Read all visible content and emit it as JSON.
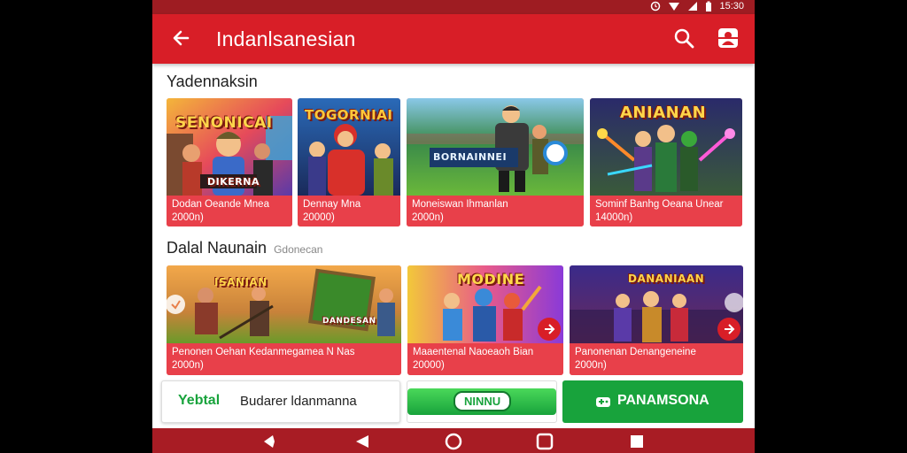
{
  "status": {
    "time": "15:30"
  },
  "appbar": {
    "title": "Indanlsanesian"
  },
  "section1": {
    "title": "Yadennaksin",
    "cards": [
      {
        "banner": "SENONICAI",
        "subbanner": "DIKERNA",
        "caption": "Dodan Oeande Mnea",
        "price": "2000n)"
      },
      {
        "banner": "TOGORNIAI",
        "caption": "Dennay Mna",
        "price": "20000)"
      },
      {
        "banner": "BORNAINNEI",
        "caption": "Moneiswan Ihmanlan",
        "price": "2000n)"
      },
      {
        "banner": "ANIANAN",
        "caption": "Sominf Banhg Oeana Unear",
        "price": "14000n)"
      }
    ]
  },
  "section2": {
    "title": "Dalal Naunain",
    "subtitle": "Gdonecan",
    "cards": [
      {
        "banner": "ISANIAN",
        "subbanner": "DANDESAN",
        "caption": "Penonen Oehan Kedanmegamea N Nas",
        "price": "2000n)"
      },
      {
        "banner": "MODINE",
        "caption": "Maaentenal Naoeaoh Bian",
        "price": "20000)"
      },
      {
        "banner": "DANANIAAN",
        "caption": "Panonenan Denangeneine",
        "price": "2000n)"
      }
    ]
  },
  "bottom": {
    "tag1": "Yebtal",
    "text1": "Budarer ldanmanna",
    "pill": "NINNU",
    "button": "PANAMSONA"
  },
  "colors": {
    "appbar": "#d81e27",
    "caption": "#e8404a",
    "green": "#18a33c"
  }
}
